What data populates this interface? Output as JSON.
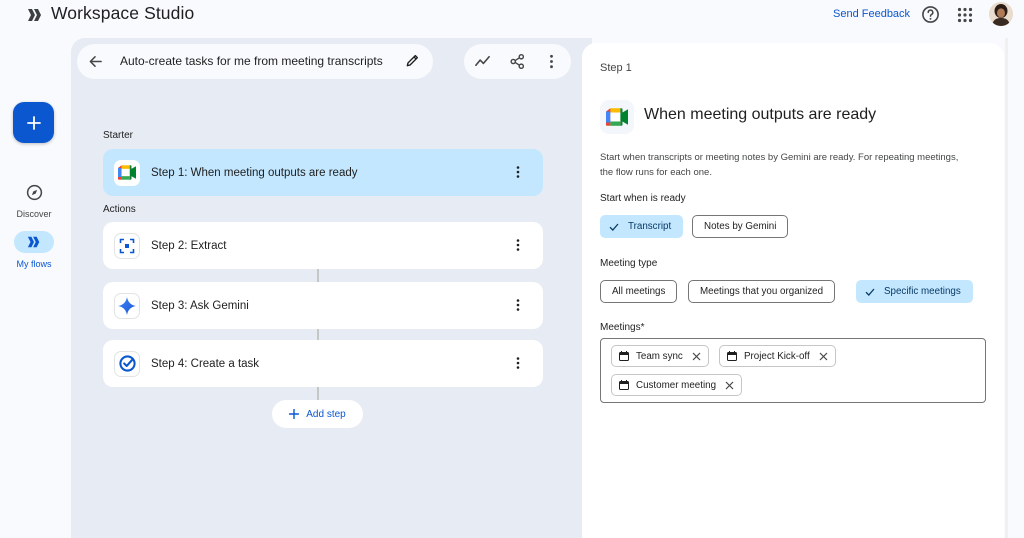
{
  "app": {
    "title": "Workspace Studio",
    "feedback_label": "Send Feedback"
  },
  "rail": {
    "discover_label": "Discover",
    "flows_label": "My flows"
  },
  "flow": {
    "title": "Auto-create tasks for me from meeting transcripts"
  },
  "canvas": {
    "starter_label": "Starter",
    "actions_label": "Actions",
    "steps": [
      {
        "prefix": "Step 1:",
        "label": " When meeting outputs are ready",
        "icon": "google-meet-icon"
      },
      {
        "prefix": "Step 2:",
        "label": " Extract",
        "icon": "extract-icon"
      },
      {
        "prefix": "Step 3:",
        "label": " Ask Gemini",
        "icon": "gemini-sparkle-icon"
      },
      {
        "prefix": "Step 4:",
        "label": " Create a task",
        "icon": "google-tasks-icon"
      }
    ],
    "add_step_label": "Add step"
  },
  "panel": {
    "step_label": "Step 1",
    "heading": "When meeting outputs are ready",
    "description": "Start when transcripts or meeting notes by Gemini are ready. For repeating meetings, the flow runs for each one.",
    "start_when_label": "Start when is ready",
    "start_when_options": [
      {
        "label": "Transcript",
        "selected": true
      },
      {
        "label": "Notes by Gemini",
        "selected": false
      }
    ],
    "meeting_type_label": "Meeting type",
    "meeting_type_options": [
      {
        "label": "All meetings",
        "selected": false
      },
      {
        "label": "Meetings that you organized",
        "selected": false
      },
      {
        "label": "Specific meetings",
        "selected": true
      }
    ],
    "meetings_label": "Meetings*",
    "meetings": [
      "Team sync",
      "Project Kick-off",
      "Customer meeting"
    ]
  },
  "colors": {
    "accent": "#0b57d0",
    "selected": "#c2e7ff",
    "canvas_bg": "#e7ebf3",
    "page_bg": "#f8fafd"
  }
}
